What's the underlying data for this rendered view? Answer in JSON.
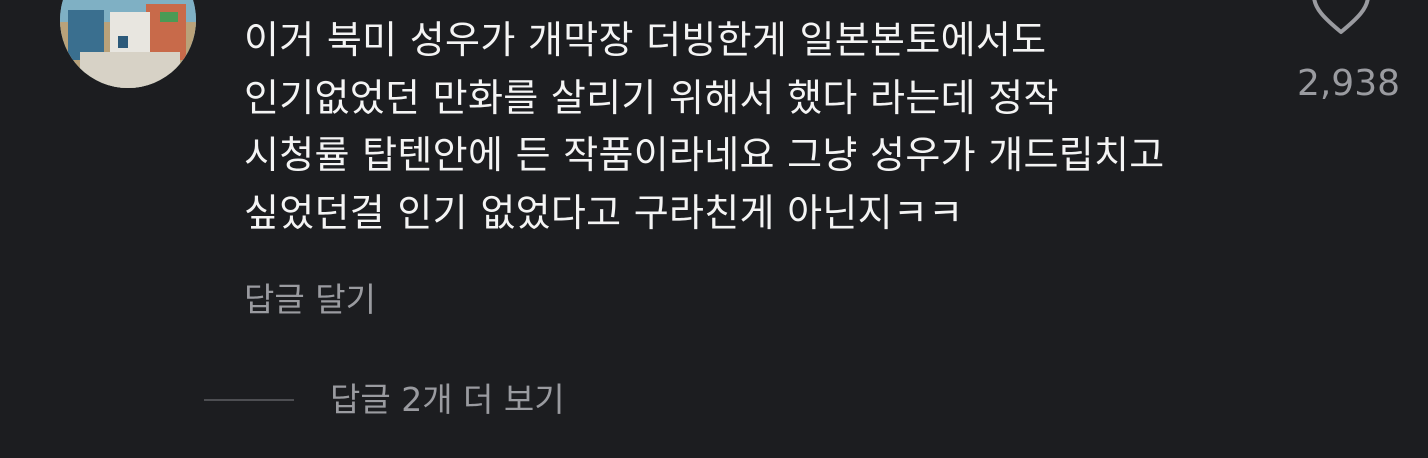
{
  "comment": {
    "lines": [
      "이거 북미 성우가 개막장 더빙한게 일본본토에서도",
      "인기없었던 만화를 살리기 위해서 했다 라는데 정작",
      "시청률 탑텐안에 든 작품이라네요 그냥 성우가 개드립치고",
      "싶었던걸 인기 없었다고 구라친게 아닌지ㅋㅋ"
    ],
    "reply_label": "답글 달기",
    "like_count": "2,938",
    "like_icon": "heart-outline-icon"
  },
  "more_replies": {
    "label": "답글 2개 더 보기"
  },
  "colors": {
    "background": "#1c1d20",
    "text": "#f4f4f4",
    "muted": "#9a9ba0"
  }
}
